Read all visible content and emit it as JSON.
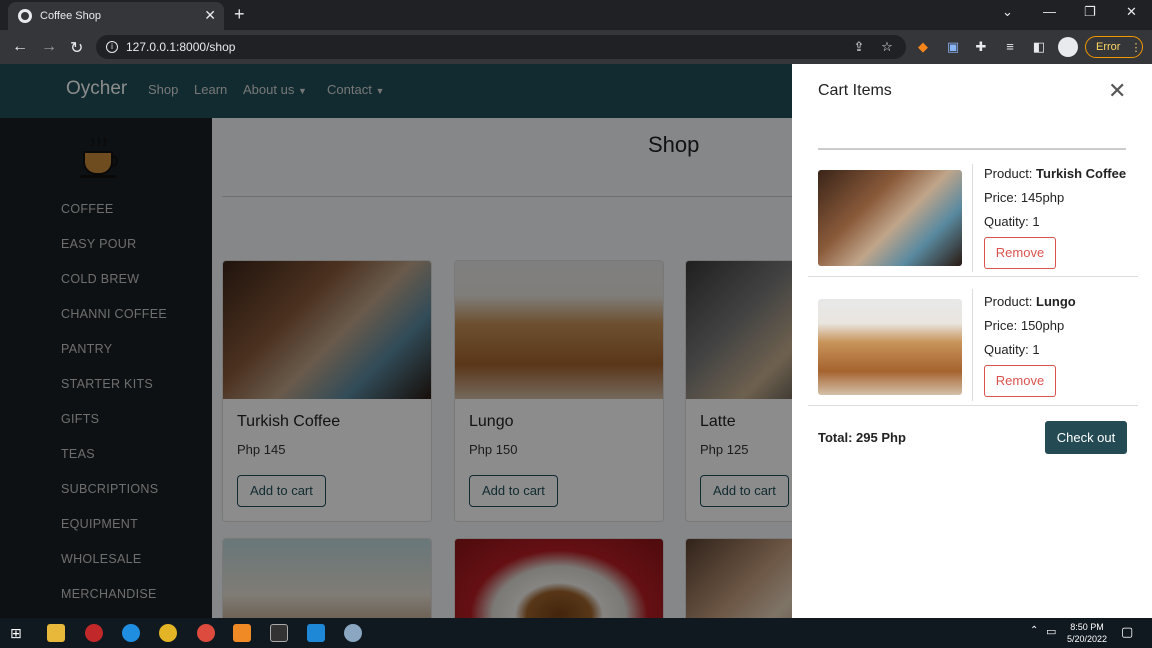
{
  "browser": {
    "tab_title": "Coffee Shop",
    "url": "127.0.0.1:8000/shop",
    "error_label": "Error"
  },
  "navbar": {
    "brand": "Oycher",
    "links": [
      "Shop",
      "Learn",
      "About us",
      "Contact"
    ]
  },
  "sidebar": {
    "items": [
      "COFFEE",
      "EASY POUR",
      "COLD BREW",
      "CHANNI COFFEE",
      "PANTRY",
      "STARTER KITS",
      "GIFTS",
      "TEAS",
      "SUBCRIPTIONS",
      "EQUIPMENT",
      "WHOLESALE",
      "MERCHANDISE"
    ]
  },
  "shop": {
    "title": "Shop",
    "products": [
      {
        "name": "Turkish Coffee",
        "price": "Php 145",
        "button": "Add to cart"
      },
      {
        "name": "Lungo",
        "price": "Php 150",
        "button": "Add to cart"
      },
      {
        "name": "Latte",
        "price": "Php 125",
        "button": "Add to cart"
      }
    ]
  },
  "cart": {
    "title": "Cart Items",
    "items": [
      {
        "product_label": "Product:",
        "product": "Turkish Coffee",
        "price": "Price: 145php",
        "quantity": "Quatity: 1",
        "remove": "Remove"
      },
      {
        "product_label": "Product:",
        "product": "Lungo",
        "price": "Price: 150php",
        "quantity": "Quatity: 1",
        "remove": "Remove"
      }
    ],
    "total": "Total: 295 Php",
    "checkout": "Check out"
  },
  "taskbar": {
    "time": "8:50 PM",
    "date": "5/20/2022"
  },
  "colors": {
    "navbar": "#1f4f58",
    "sidebar": "#1b2024",
    "checkout": "#244b53",
    "remove": "#d9534f"
  }
}
